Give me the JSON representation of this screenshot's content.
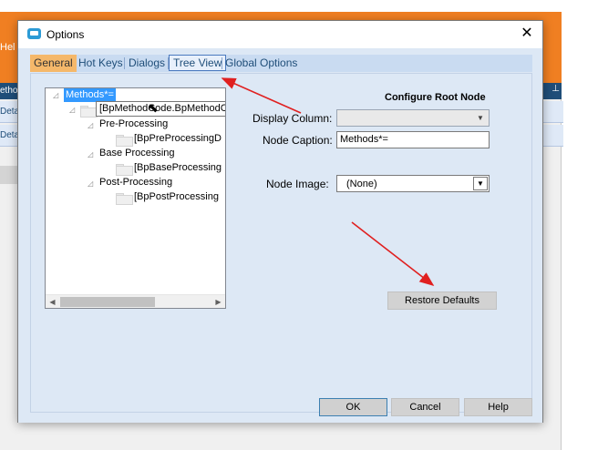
{
  "background": {
    "help_text": "Hel",
    "rows": [
      "ethod",
      "Deta",
      "Deta"
    ],
    "pin_icon": "pin-icon"
  },
  "dialog": {
    "title": "Options",
    "close_glyph": "✕",
    "tabs": [
      {
        "label": "General"
      },
      {
        "label": "Hot Keys"
      },
      {
        "label": "Dialogs"
      },
      {
        "label": "Tree View"
      },
      {
        "label": "Global Options"
      }
    ],
    "active_tab": "Tree View",
    "tree": {
      "root": "Methods*=",
      "tooltip": "[BpMethodCode.BpMethodCode]",
      "nodes": [
        {
          "label": "Pre-Processing",
          "child": "[BpPreProcessingD"
        },
        {
          "label": "Base Processing",
          "child": "[BpBaseProcessing"
        },
        {
          "label": "Post-Processing",
          "child": "[BpPostProcessing"
        }
      ]
    },
    "configure": {
      "heading": "Configure Root Node",
      "display_column_label": "Display Column:",
      "display_column_value": "",
      "node_caption_label": "Node Caption:",
      "node_caption_value": "Methods*=",
      "node_image_label": "Node Image:",
      "node_image_value": "(None)"
    },
    "restore_defaults": "Restore Defaults",
    "buttons": {
      "ok": "OK",
      "cancel": "Cancel",
      "help": "Help"
    }
  },
  "colors": {
    "accent_orange": "#f07f22",
    "selection_blue": "#3399ff",
    "arrow_red": "#e02020"
  }
}
